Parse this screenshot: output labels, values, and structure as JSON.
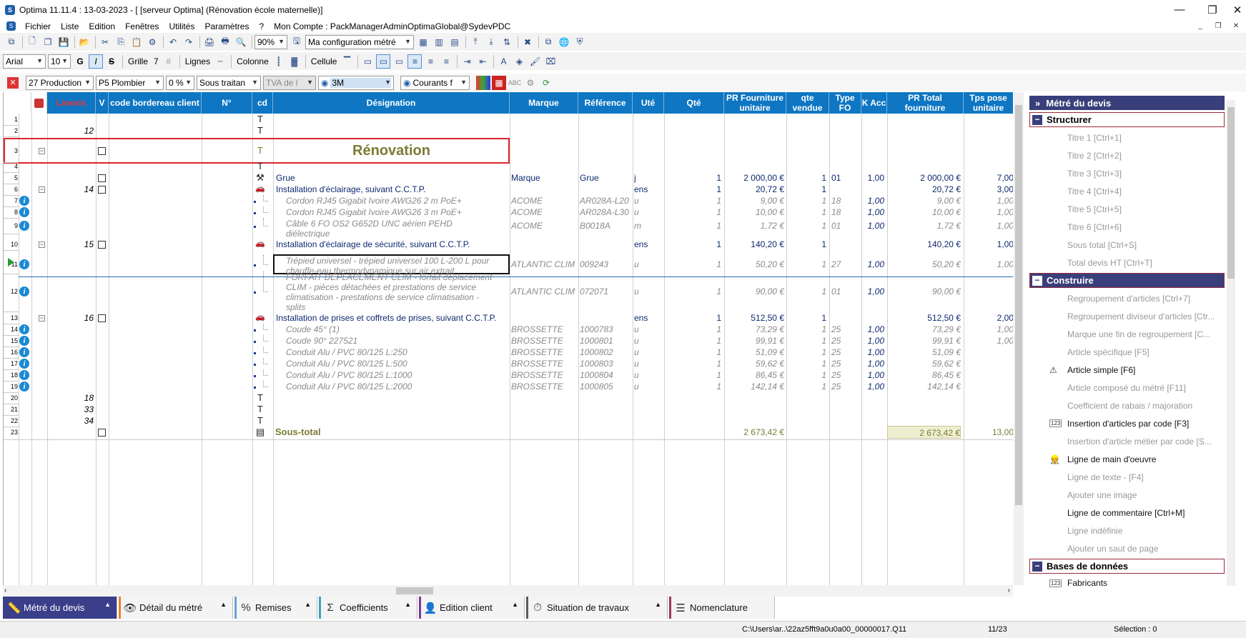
{
  "window": {
    "title": "Optima 11.11.4 : 13-03-2023 - [ [serveur Optima] (Rénovation école maternelle)]",
    "app_icon": "optima-logo-icon",
    "controls": {
      "minimize": "—",
      "maximize": "❐",
      "close": "✕"
    }
  },
  "menu": {
    "items": [
      "Fichier",
      "Liste",
      "Edition",
      "Fenêtres",
      "Utilités",
      "Paramètres",
      "?"
    ],
    "account": "Mon Compte : PackManagerAdminOptimaGlobal@SydevPDC"
  },
  "toolbar1": {
    "zoom": "90%",
    "config": "Ma configuration métré"
  },
  "toolbar2": {
    "font": "Arial",
    "size": "10",
    "grille_label": "Grille",
    "grille_val": "7",
    "lignes_label": "Lignes",
    "colonne_label": "Colonne",
    "cellule_label": "Cellule"
  },
  "toolbar3": {
    "production": "27  Production",
    "plombier": "P5  Plombier",
    "pct": "0 %",
    "sous_traitan": "Sous traitan",
    "tva": "TVA de l",
    "fournisseur": "3M",
    "courants": "Courants f"
  },
  "columns": [
    "Linexis",
    "V",
    "code bordereau client",
    "N°",
    "cd",
    "Désignation",
    "Marque",
    "Référence",
    "Uté",
    "Qté",
    "PR Fourniture unitaire",
    "qte vendue",
    "Type FO",
    "K Acc",
    "PR Total fourniture",
    "Tps pose unitaire"
  ],
  "rows": [
    {
      "n": "1",
      "lin": "",
      "cd": "T",
      "des": "",
      "style": "normal"
    },
    {
      "n": "2",
      "lin": "12",
      "cd": "T",
      "des": "",
      "style": "normal"
    },
    {
      "n": "3",
      "lin": "",
      "cd": "T+",
      "des": "Rénovation",
      "style": "title"
    },
    {
      "n": "4",
      "lin": "",
      "cd": "T",
      "des": "",
      "style": "normal"
    },
    {
      "n": "5",
      "lin": "",
      "cd": "grue",
      "des": "Grue",
      "marque": "Marque",
      "ref": "Grue",
      "ute": "j",
      "qte": "1",
      "pru": "2 000,00 €",
      "qv": "1",
      "type": "01",
      "k": "1,00",
      "prt": "2 000,00 €",
      "tps": "7,00",
      "style": "navy"
    },
    {
      "n": "6",
      "lin": "14",
      "cd": "car",
      "des": "Installation d'éclairage, suivant C.C.T.P.",
      "ute": "ens",
      "qte": "1",
      "pru": "20,72 €",
      "qv": "1",
      "prt": "20,72 €",
      "tps": "3,00",
      "style": "navy"
    },
    {
      "n": "7",
      "des": "Cordon RJ45 Gigabit Ivoire AWG26 2 m PoE+",
      "marque": "ACOME",
      "ref": "AR028A-L20",
      "ute": "u",
      "qte": "1",
      "pru": "9,00 €",
      "qv": "1",
      "type": "18",
      "k": "1,00",
      "prt": "9,00 €",
      "tps": "1,00",
      "style": "gray"
    },
    {
      "n": "8",
      "des": "Cordon RJ45 Gigabit Ivoire AWG26 3 m PoE+",
      "marque": "ACOME",
      "ref": "AR028A-L30",
      "ute": "u",
      "qte": "1",
      "pru": "10,00 €",
      "qv": "1",
      "type": "18",
      "k": "1,00",
      "prt": "10,00 €",
      "tps": "1,00",
      "style": "gray"
    },
    {
      "n": "9",
      "des": "Câble 6 FO OS2 G652D UNC aérien PEHD",
      "des2": "diélectrique",
      "marque": "ACOME",
      "ref": "B0018A",
      "ute": "m",
      "qte": "1",
      "pru": "1,72 €",
      "qv": "1",
      "type": "01",
      "k": "1,00",
      "prt": "1,72 €",
      "tps": "1,00",
      "style": "gray"
    },
    {
      "n": "10",
      "lin": "15",
      "cd": "car",
      "des": "Installation d'éclairage de sécurité, suivant C.C.T.P.",
      "ute": "ens",
      "qte": "1",
      "pru": "140,20 €",
      "qv": "1",
      "prt": "140,20 €",
      "tps": "1,00",
      "style": "navy"
    },
    {
      "n": "11",
      "des": "Trépied universel - trépied universel 100 L-200 L pour",
      "des2": "chauffe-eau thermodynamique sur air extrait",
      "marque": "ATLANTIC CLIM",
      "ref": "009243",
      "ute": "u",
      "qte": "1",
      "pru": "50,20 €",
      "qv": "1",
      "type": "27",
      "k": "1,00",
      "prt": "50,20 €",
      "tps": "1,00",
      "style": "gray"
    },
    {
      "n": "12",
      "des": "FORFAIT DEPLACEMENT CLIM - forfait déplacement",
      "des2": "CLIM - pièces détachées et prestations de service",
      "des3": "climatisation - prestations de service climatisation -",
      "des4": "splits",
      "marque": "ATLANTIC CLIM",
      "ref": "072071",
      "ute": "u",
      "qte": "1",
      "pru": "90,00 €",
      "qv": "1",
      "type": "01",
      "k": "1,00",
      "prt": "90,00 €",
      "tps": "",
      "style": "gray"
    },
    {
      "n": "13",
      "lin": "16",
      "cd": "car",
      "des": "Installation de prises et coffrets de prises, suivant C.C.T.P.",
      "ute": "ens",
      "qte": "1",
      "pru": "512,50 €",
      "qv": "1",
      "prt": "512,50 €",
      "tps": "2,00",
      "style": "navy"
    },
    {
      "n": "14",
      "des": "Coude 45° (1)",
      "marque": "BROSSETTE",
      "ref": "1000783",
      "ute": "u",
      "qte": "1",
      "pru": "73,29 €",
      "qv": "1",
      "type": "25",
      "k": "1,00",
      "prt": "73,29 €",
      "tps": "1,00",
      "style": "gray"
    },
    {
      "n": "15",
      "des": "Coude 90° 227521",
      "marque": "BROSSETTE",
      "ref": "1000801",
      "ute": "u",
      "qte": "1",
      "pru": "99,91 €",
      "qv": "1",
      "type": "25",
      "k": "1,00",
      "prt": "99,91 €",
      "tps": "1,00",
      "style": "gray"
    },
    {
      "n": "16",
      "des": "Conduit Alu / PVC 80/125 L:250",
      "marque": "BROSSETTE",
      "ref": "1000802",
      "ute": "u",
      "qte": "1",
      "pru": "51,09 €",
      "qv": "1",
      "type": "25",
      "k": "1,00",
      "prt": "51,09 €",
      "tps": "",
      "style": "gray"
    },
    {
      "n": "17",
      "des": "Conduit Alu / PVC 80/125 L:500",
      "marque": "BROSSETTE",
      "ref": "1000803",
      "ute": "u",
      "qte": "1",
      "pru": "59,62 €",
      "qv": "1",
      "type": "25",
      "k": "1,00",
      "prt": "59,62 €",
      "tps": "",
      "style": "gray"
    },
    {
      "n": "18",
      "des": "Conduit Alu / PVC 80/125 L:1000",
      "marque": "BROSSETTE",
      "ref": "1000804",
      "ute": "u",
      "qte": "1",
      "pru": "86,45 €",
      "qv": "1",
      "type": "25",
      "k": "1,00",
      "prt": "86,45 €",
      "tps": "",
      "style": "gray"
    },
    {
      "n": "19",
      "des": "Conduit Alu / PVC 80/125 L:2000",
      "marque": "BROSSETTE",
      "ref": "1000805",
      "ute": "u",
      "qte": "1",
      "pru": "142,14 €",
      "qv": "1",
      "type": "25",
      "k": "1,00",
      "prt": "142,14 €",
      "tps": "",
      "style": "gray"
    },
    {
      "n": "20",
      "lin": "18",
      "cd": "T",
      "style": "normal"
    },
    {
      "n": "21",
      "lin": "33",
      "cd": "T",
      "style": "normal"
    },
    {
      "n": "22",
      "lin": "34",
      "cd": "T",
      "style": "normal"
    },
    {
      "n": "23",
      "cd": "sum",
      "des": "Sous-total",
      "pru": "2 673,42 €",
      "prt": "2 673,42 €",
      "tps": "13,00",
      "style": "subtotal"
    }
  ],
  "side_panel": {
    "header": "Métré du devis",
    "sections": [
      {
        "label": "Structurer",
        "items": [
          "Titre 1 [Ctrl+1]",
          "Titre 2 [Ctrl+2]",
          "Titre 3 [Ctrl+3]",
          "Titre 4 [Ctrl+4]",
          "Titre 5 [Ctrl+5]",
          "Titre 6 [Ctrl+6]",
          "Sous total [Ctrl+S]",
          "Total devis HT [Ctrl+T]"
        ]
      },
      {
        "label": "Construire",
        "items": [
          "Regroupement d'articles  [Ctrl+7]",
          "Regroupement diviseur d'articles [Ctr...",
          "Marque une fin de regroupement  [C...",
          "Article spécifique [F5]",
          "Article simple [F6]",
          "Article composé du métré [F11]",
          "Coefficient de rabais / majoration",
          "Insertion d'articles par code [F3]",
          "Insertion d'article métier par code [S...",
          "Ligne de main d'oeuvre",
          "Ligne de texte - [F4]",
          "Ajouter une image",
          "Ligne de commentaire [Ctrl+M]",
          "Ligne indéfinie",
          "Ajouter un saut de page"
        ]
      },
      {
        "label": "Bases de données",
        "items": [
          "Fabricants"
        ]
      }
    ]
  },
  "bottom_tabs": [
    "Métré du devis",
    "Détail du métré",
    "Remises",
    "Coefficients",
    "Edition client",
    "Situation de travaux",
    "Nomenclature"
  ],
  "status": {
    "path": "C:\\Users\\ar..\\22az5fft9a0u0a00_00000017.Q11",
    "position": "11/23",
    "selection": "Sélection : 0"
  }
}
